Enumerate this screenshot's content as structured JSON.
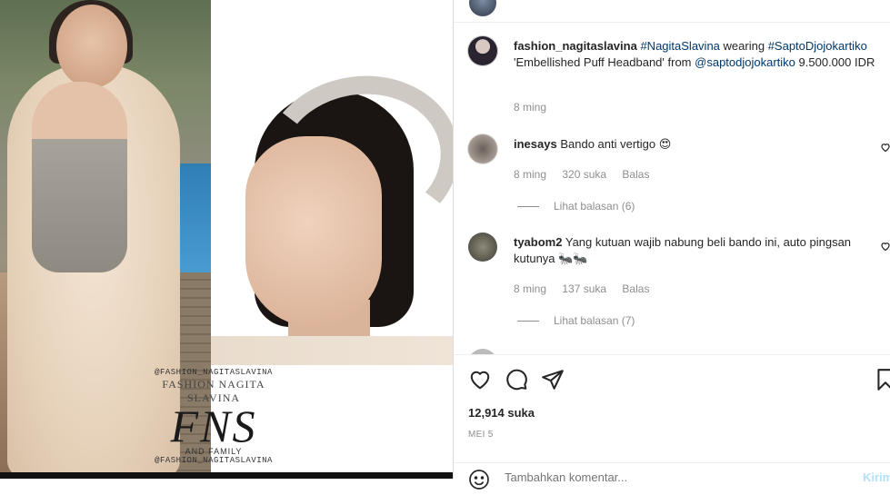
{
  "photo": {
    "watermark": {
      "handle_top": "@FASHION_NAGITASLAVINA",
      "name": "FASHION NAGITA SLAVINA",
      "logo": "FNS",
      "sub": "AND FAMILY",
      "handle_bottom": "@FASHION_NAGITASLAVINA"
    }
  },
  "post": {
    "caption": {
      "username": "fashion_nagitaslavina",
      "tag1": "#NagitaSlavina",
      "mid_text": "wearing",
      "tag2": "#SaptoDjojokartiko",
      "text_before_mention": "'Embellished Puff Headband' from",
      "mention": "@saptodjojokartiko",
      "text_after_mention": "9.500.000 IDR",
      "time": "8 ming"
    },
    "comments": [
      {
        "username": "inesays",
        "text": "Bando anti vertigo",
        "emoji": "😍",
        "time": "8 ming",
        "likes": "320 suka",
        "reply_label": "Balas",
        "view_replies": "Lihat balasan (6)"
      },
      {
        "username": "tyabom2",
        "text": "Yang kutuan wajib nabung beli bando ini, auto pingsan kutunya",
        "emoji": "🐜🐜",
        "time": "8 ming",
        "likes": "137 suka",
        "reply_label": "Balas",
        "view_replies": "Lihat balasan (7)"
      }
    ],
    "likes_count": "12,914 suka",
    "date": "MEI 5",
    "add_comment_placeholder": "Tambahkan komentar...",
    "post_label": "Kirim"
  },
  "icons": [
    "heart-icon",
    "comment-icon",
    "share-icon",
    "bookmark-icon",
    "emoji-icon"
  ],
  "colors": {
    "link": "#00376b",
    "muted": "#8e8e8e",
    "text": "#262626",
    "post_disabled": "#b2dffc"
  }
}
